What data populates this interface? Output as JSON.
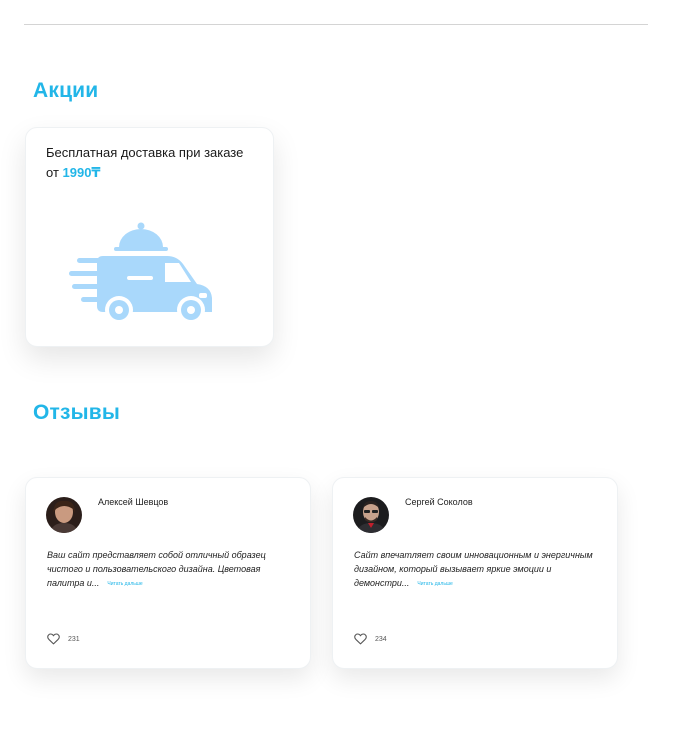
{
  "promotions": {
    "title": "Акции",
    "card": {
      "text_before": "Бесплатная доставка при заказе от ",
      "price": "1990₸",
      "icon": "delivery-car-icon",
      "icon_color": "#a9d8fb"
    }
  },
  "reviews": {
    "title": "Отзывы",
    "items": [
      {
        "author": "Алексей Шевцов",
        "text": "Ваш сайт представляет собой отличный образец чистого и пользовательского дизайна. Цветовая палитра и...",
        "read_more": "Читать дальше",
        "likes": "231"
      },
      {
        "author": "Сергей Соколов",
        "text": "Сайт впечатляет своим инновационным и энергичным дизайном, который вызывает яркие эмоции и демонстри...",
        "read_more": "Читать дальше",
        "likes": "234"
      }
    ]
  },
  "colors": {
    "accent": "#22b6e8",
    "divider": "#d4d4d4"
  }
}
